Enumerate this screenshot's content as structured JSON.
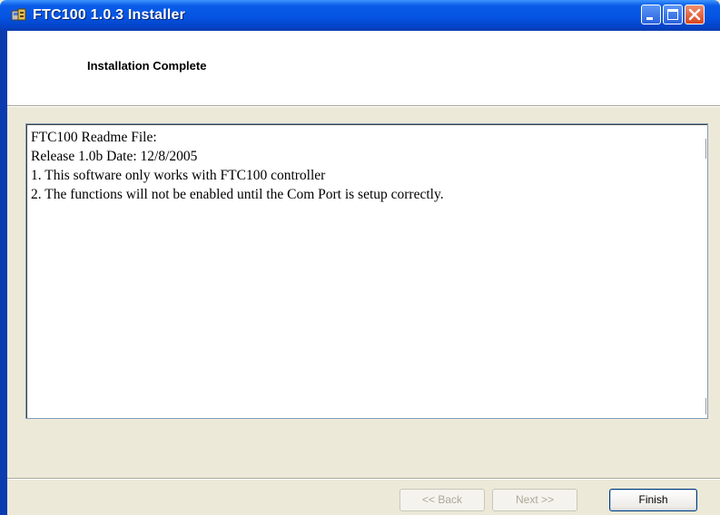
{
  "window": {
    "title": "FTC100 1.0.3 Installer",
    "icon": "installer-app-icon"
  },
  "titlebar_buttons": {
    "minimize": "minimize-icon",
    "maximize": "maximize-icon",
    "close": "close-icon"
  },
  "header": {
    "title": "Installation Complete"
  },
  "readme": {
    "lines": [
      "FTC100 Readme File:",
      "Release 1.0b Date: 12/8/2005",
      "1. This software only works with FTC100 controller",
      "2. The functions will not be enabled until the Com Port is setup correctly."
    ]
  },
  "buttons": {
    "back_label": "<< Back",
    "next_label": "Next >>",
    "finish_label": "Finish"
  },
  "colors": {
    "titlebar": "#0554e3",
    "dialog_background": "#ece9d8",
    "close_button": "#d8461f"
  }
}
